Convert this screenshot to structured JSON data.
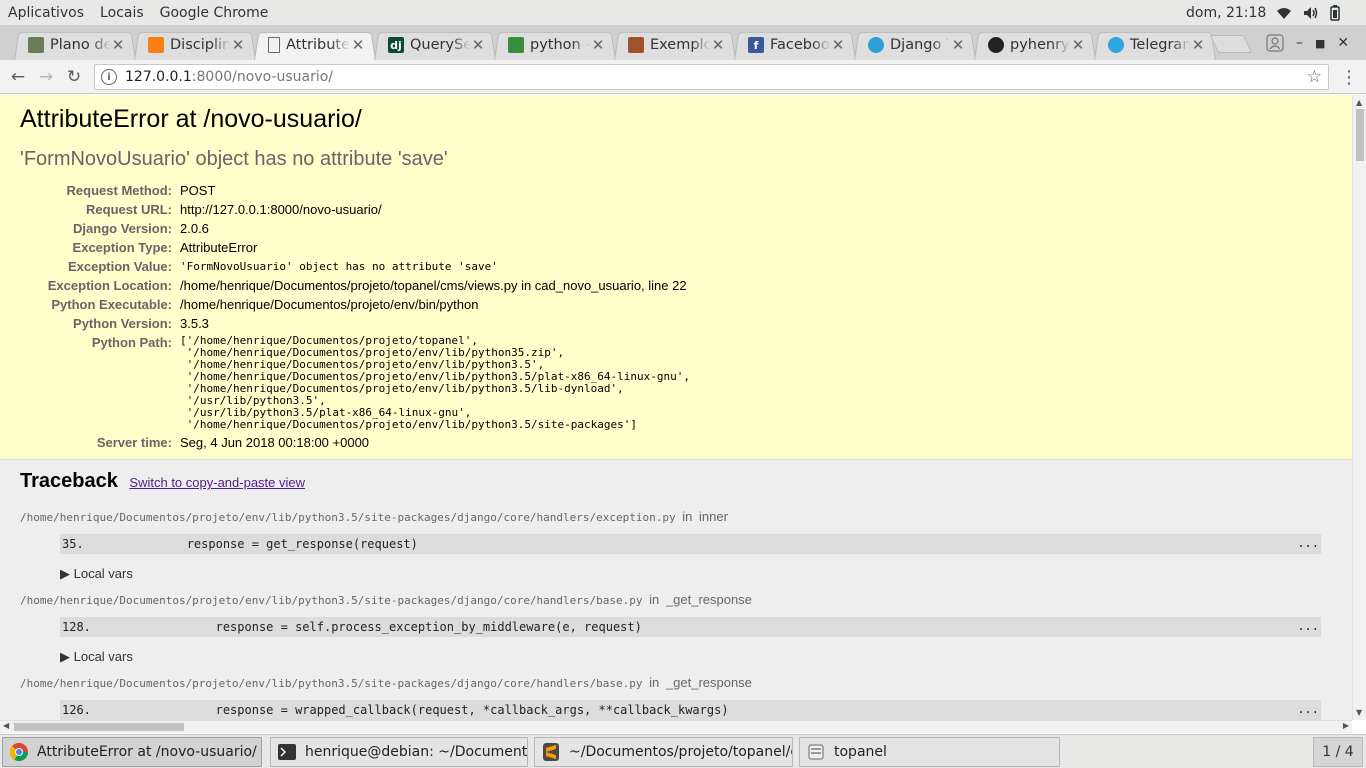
{
  "topbar": {
    "menus": [
      "Aplicativos",
      "Locais",
      "Google Chrome"
    ],
    "clock": "dom, 21:18",
    "icons": [
      "wifi-icon",
      "volume-icon",
      "battery-icon"
    ]
  },
  "tabs": [
    {
      "label": "Plano de",
      "icon": "book-favicon",
      "color": "#6b7d57"
    },
    {
      "label": "Disciplina",
      "icon": "moodle-favicon",
      "color": "#f98012"
    },
    {
      "label": "Attribute",
      "icon": "document-favicon",
      "color": "#777777",
      "active": true
    },
    {
      "label": "QuerySet",
      "icon": "django-favicon",
      "color": "#0c4b33"
    },
    {
      "label": "python -",
      "icon": "stackoverflow-favicon",
      "color": "#3a8d3a"
    },
    {
      "label": "Exemplo",
      "icon": "image-favicon",
      "color": "#a0522d"
    },
    {
      "label": "Facebook",
      "icon": "facebook-favicon",
      "color": "#3b5998"
    },
    {
      "label": "Django T",
      "icon": "pony-favicon",
      "color": "#2e9fd6"
    },
    {
      "label": "pyhenry/",
      "icon": "github-favicon",
      "color": "#222222"
    },
    {
      "label": "Telegram",
      "icon": "telegram-favicon",
      "color": "#2ca5e0"
    }
  ],
  "address": {
    "host": "127.0.0.1",
    "path": ":8000/novo-usuario/"
  },
  "error": {
    "title": "AttributeError at /novo-usuario/",
    "subtitle": "'FormNovoUsuario' object has no attribute 'save'",
    "meta": [
      {
        "label": "Request Method:",
        "value": "POST"
      },
      {
        "label": "Request URL:",
        "value": "http://127.0.0.1:8000/novo-usuario/"
      },
      {
        "label": "Django Version:",
        "value": "2.0.6"
      },
      {
        "label": "Exception Type:",
        "value": "AttributeError"
      },
      {
        "label": "Exception Value:",
        "value": "'FormNovoUsuario' object has no attribute 'save'",
        "mono": true
      },
      {
        "label": "Exception Location:",
        "value": "/home/henrique/Documentos/projeto/topanel/cms/views.py in cad_novo_usuario, line 22"
      },
      {
        "label": "Python Executable:",
        "value": "/home/henrique/Documentos/projeto/env/bin/python"
      },
      {
        "label": "Python Version:",
        "value": "3.5.3"
      },
      {
        "label": "Python Path:",
        "value": "['/home/henrique/Documentos/projeto/topanel',\n '/home/henrique/Documentos/projeto/env/lib/python35.zip',\n '/home/henrique/Documentos/projeto/env/lib/python3.5',\n '/home/henrique/Documentos/projeto/env/lib/python3.5/plat-x86_64-linux-gnu',\n '/home/henrique/Documentos/projeto/env/lib/python3.5/lib-dynload',\n '/usr/lib/python3.5',\n '/usr/lib/python3.5/plat-x86_64-linux-gnu',\n '/home/henrique/Documentos/projeto/env/lib/python3.5/site-packages']",
        "pre": true
      },
      {
        "label": "Server time:",
        "value": "Seg, 4 Jun 2018 00:18:00 +0000"
      }
    ]
  },
  "traceback": {
    "heading": "Traceback",
    "switch_link": "Switch to copy-and-paste view",
    "in_word": "in",
    "frames": [
      {
        "file": "/home/henrique/Documentos/projeto/env/lib/python3.5/site-packages/django/core/handlers/exception.py",
        "func": "inner",
        "line": "35.",
        "code": "            response = get_response(request)",
        "dots": "...",
        "localvars": "▶ Local vars"
      },
      {
        "file": "/home/henrique/Documentos/projeto/env/lib/python3.5/site-packages/django/core/handlers/base.py",
        "func": "_get_response",
        "line": "128.",
        "code": "                response = self.process_exception_by_middleware(e, request)",
        "dots": "...",
        "localvars": "▶ Local vars"
      },
      {
        "file": "/home/henrique/Documentos/projeto/env/lib/python3.5/site-packages/django/core/handlers/base.py",
        "func": "_get_response",
        "line": "126.",
        "code": "                response = wrapped_callback(request, *callback_args, **callback_kwargs)",
        "dots": "...",
        "localvars": ""
      }
    ]
  },
  "taskbar": {
    "items": [
      {
        "label": "AttributeError at /novo-usuario/ - G...",
        "icon": "chrome-icon",
        "active": true
      },
      {
        "label": "henrique@debian: ~/Documentos/pr...",
        "icon": "terminal-icon"
      },
      {
        "label": "~/Documentos/projeto/topanel/cms...",
        "icon": "sublime-icon"
      },
      {
        "label": "topanel",
        "icon": "file-manager-icon"
      }
    ],
    "workspace": "1 / 4"
  }
}
